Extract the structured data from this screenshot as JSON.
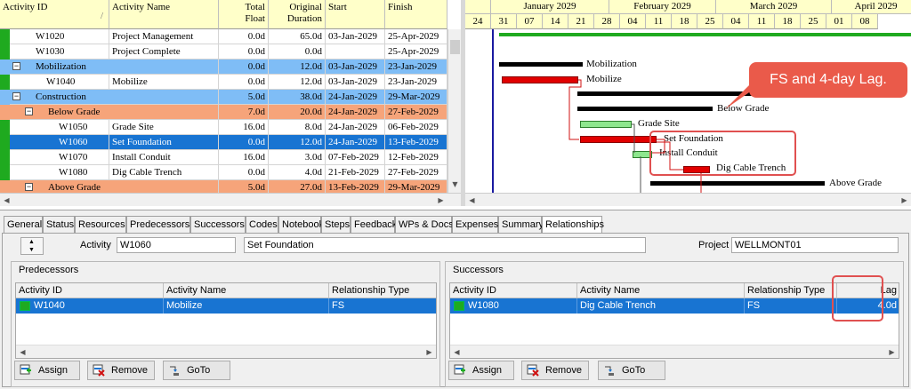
{
  "grid": {
    "headers": {
      "activity_id": "Activity ID",
      "activity_name": "Activity Name",
      "total_float": [
        "Total",
        "Float"
      ],
      "original_duration": [
        "Original",
        "Duration"
      ],
      "start": "Start",
      "finish": "Finish"
    },
    "rows": [
      {
        "id": "W1020",
        "name": "Project Management",
        "float": "0.0d",
        "duration": "65.0d",
        "start": "03-Jan-2029",
        "finish": "25-Apr-2029",
        "type": "activity",
        "style": "normal",
        "indent": 1
      },
      {
        "id": "W1030",
        "name": "Project Complete",
        "float": "0.0d",
        "duration": "0.0d",
        "start": "",
        "finish": "25-Apr-2029",
        "type": "activity",
        "style": "normal",
        "indent": 1
      },
      {
        "id": "Mobilization",
        "name": "",
        "float": "0.0d",
        "duration": "12.0d",
        "start": "03-Jan-2029",
        "finish": "23-Jan-2029",
        "type": "wbs",
        "style": "wbs-blue",
        "indent": 1
      },
      {
        "id": "W1040",
        "name": "Mobilize",
        "float": "0.0d",
        "duration": "12.0d",
        "start": "03-Jan-2029",
        "finish": "23-Jan-2029",
        "type": "activity",
        "style": "normal",
        "indent": 2
      },
      {
        "id": "Construction",
        "name": "",
        "float": "5.0d",
        "duration": "38.0d",
        "start": "24-Jan-2029",
        "finish": "29-Mar-2029",
        "type": "wbs",
        "style": "wbs-blue",
        "indent": 1
      },
      {
        "id": "Below Grade",
        "name": "",
        "float": "7.0d",
        "duration": "20.0d",
        "start": "24-Jan-2029",
        "finish": "27-Feb-2029",
        "type": "wbs",
        "style": "wbs-orange",
        "indent": 2
      },
      {
        "id": "W1050",
        "name": "Grade Site",
        "float": "16.0d",
        "duration": "8.0d",
        "start": "24-Jan-2029",
        "finish": "06-Feb-2029",
        "type": "activity",
        "style": "normal",
        "indent": 3
      },
      {
        "id": "W1060",
        "name": "Set Foundation",
        "float": "0.0d",
        "duration": "12.0d",
        "start": "24-Jan-2029",
        "finish": "13-Feb-2029",
        "type": "activity",
        "style": "selected",
        "indent": 3
      },
      {
        "id": "W1070",
        "name": "Install Conduit",
        "float": "16.0d",
        "duration": "3.0d",
        "start": "07-Feb-2029",
        "finish": "12-Feb-2029",
        "type": "activity",
        "style": "normal",
        "indent": 3
      },
      {
        "id": "W1080",
        "name": "Dig Cable Trench",
        "float": "0.0d",
        "duration": "4.0d",
        "start": "21-Feb-2029",
        "finish": "27-Feb-2029",
        "type": "activity",
        "style": "normal",
        "indent": 3
      },
      {
        "id": "Above Grade",
        "name": "",
        "float": "5.0d",
        "duration": "27.0d",
        "start": "13-Feb-2029",
        "finish": "29-Mar-2029",
        "type": "wbs",
        "style": "wbs-orange",
        "indent": 2
      }
    ]
  },
  "gantt": {
    "months": [
      "January 2029",
      "February 2029",
      "March 2029",
      "April 2029"
    ],
    "days": [
      "24",
      "31",
      "07",
      "14",
      "21",
      "28",
      "04",
      "11",
      "18",
      "25",
      "04",
      "11",
      "18",
      "25",
      "01",
      "08"
    ],
    "bar_labels": [
      "Mobilization",
      "Mobilize",
      "Below Grade",
      "Grade Site",
      "Set Foundation",
      "Install Conduit",
      "Dig Cable Trench",
      "Above Grade"
    ],
    "callout": "FS and 4-day Lag."
  },
  "tabs": [
    "General",
    "Status",
    "Resources",
    "Predecessors",
    "Successors",
    "Codes",
    "Notebook",
    "Steps",
    "Feedback",
    "WPs & Docs",
    "Expenses",
    "Summary",
    "Relationships"
  ],
  "active_tab": "Relationships",
  "detail": {
    "activity_label": "Activity",
    "activity_id": "W1060",
    "activity_name": "Set Foundation",
    "project_label": "Project",
    "project_id": "WELLMONT01"
  },
  "predecessors": {
    "title": "Predecessors",
    "headers": [
      "Activity ID",
      "Activity Name",
      "Relationship Type"
    ],
    "rows": [
      {
        "id": "W1040",
        "name": "Mobilize",
        "type": "FS"
      }
    ]
  },
  "successors": {
    "title": "Successors",
    "headers": [
      "Activity ID",
      "Activity Name",
      "Relationship Type",
      "Lag"
    ],
    "rows": [
      {
        "id": "W1080",
        "name": "Dig Cable Trench",
        "type": "FS",
        "lag": "4.0d"
      }
    ]
  },
  "buttons": {
    "assign": "Assign",
    "remove": "Remove",
    "goto": "GoTo"
  },
  "colors": {
    "wbs_blue": "#7fbdf6",
    "wbs_orange": "#f6a47a",
    "selected": "#1874d2",
    "gutter_green": "#1faa1f",
    "callout": "#ea5a4a"
  }
}
